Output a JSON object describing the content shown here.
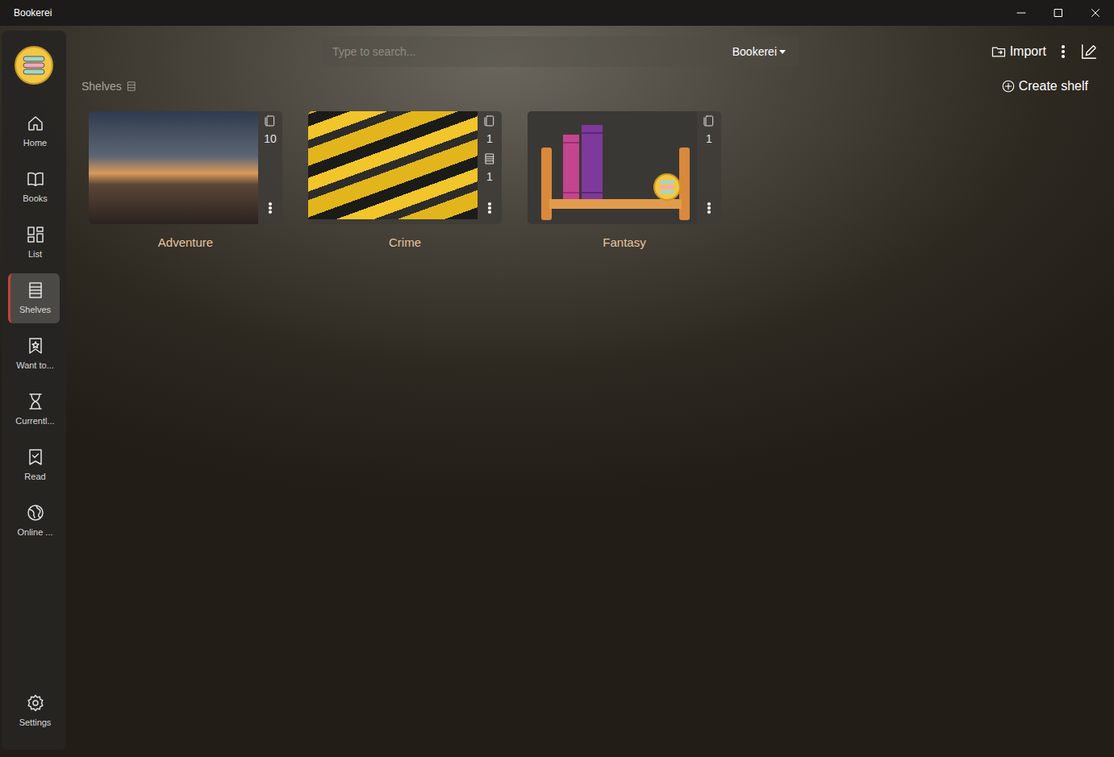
{
  "window": {
    "title": "Bookerei"
  },
  "sidebar": {
    "items": [
      {
        "label": "Home",
        "selected": false
      },
      {
        "label": "Books",
        "selected": false
      },
      {
        "label": "List",
        "selected": false
      },
      {
        "label": "Shelves",
        "selected": true
      },
      {
        "label": "Want to...",
        "selected": false
      },
      {
        "label": "Currentl...",
        "selected": false
      },
      {
        "label": "Read",
        "selected": false
      },
      {
        "label": "Online ...",
        "selected": false
      }
    ],
    "settings": "Settings"
  },
  "search": {
    "placeholder": "Type to search...",
    "source": "Bookerei"
  },
  "toolbar": {
    "import": "Import"
  },
  "header": {
    "title": "Shelves",
    "create": "Create shelf"
  },
  "shelves": [
    {
      "name": "Adventure",
      "kind": "photo",
      "books": "10",
      "subshelves": ""
    },
    {
      "name": "Crime",
      "kind": "photo",
      "books": "1",
      "subshelves": "1"
    },
    {
      "name": "Fantasy",
      "kind": "illustration",
      "books": "1",
      "subshelves": ""
    }
  ]
}
